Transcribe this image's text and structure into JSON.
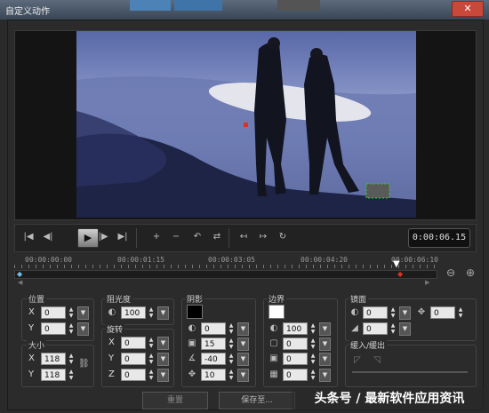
{
  "window": {
    "title": "自定义动作",
    "close_glyph": "✕"
  },
  "transport": {
    "buttons": [
      {
        "name": "go-to-start-button",
        "glyph": "|◀"
      },
      {
        "name": "previous-frame-button",
        "glyph": "◀|"
      },
      {
        "name": "play-button",
        "glyph": "▶"
      },
      {
        "name": "next-frame-button",
        "glyph": "|▶"
      },
      {
        "name": "go-to-end-button",
        "glyph": "▶|"
      }
    ],
    "edit_buttons": [
      {
        "name": "add-keyframe-button",
        "glyph": "+"
      },
      {
        "name": "remove-keyframe-button",
        "glyph": "−"
      },
      {
        "name": "reverse-keyframes-button",
        "glyph": "↶"
      },
      {
        "name": "swap-keyframes-button",
        "glyph": "⇄"
      },
      {
        "name": "move-left-keyframe-button",
        "glyph": "↤"
      },
      {
        "name": "move-right-keyframe-button",
        "glyph": "↦"
      },
      {
        "name": "redo-button",
        "glyph": "↻"
      }
    ],
    "timecode": "0:00:06.15"
  },
  "timeline": {
    "labels": [
      "00:00:00:00",
      "00:00:01:15",
      "00:00:03:05",
      "00:00:04:20",
      "00:00:06:10"
    ],
    "zoom_out": "⊖",
    "zoom_in": "⊕"
  },
  "position": {
    "title": "位置",
    "x_label": "X",
    "x": "0",
    "y_label": "Y",
    "y": "0"
  },
  "size": {
    "title": "大小",
    "x_label": "X",
    "x": "118",
    "y_label": "Y",
    "y": "118",
    "link_glyph": "⛓"
  },
  "opacity": {
    "title": "阻光度",
    "value": "100"
  },
  "rotation": {
    "title": "旋转",
    "x_label": "X",
    "x": "0",
    "y_label": "Y",
    "y": "0",
    "z_label": "Z",
    "z": "0"
  },
  "shadow": {
    "title": "阴影",
    "color": "#000000",
    "opacity": "0",
    "blur": "15",
    "angle": "-40",
    "distance": "10"
  },
  "border": {
    "title": "边界",
    "color": "#ffffff",
    "opacity": "100",
    "width": "0",
    "val3": "0",
    "val4": "0"
  },
  "mirror": {
    "title": "镜面",
    "opacity": "0",
    "offset": "0",
    "fade": "0"
  },
  "fade": {
    "title": "缓入/缓出"
  },
  "footer": {
    "reset": "重置",
    "save_as": "保存至..."
  },
  "watermark": "头条号 / 最新软件应用资讯",
  "colors": {
    "accent": "#4c82b5",
    "close": "#c8483a",
    "keyframe": "#ffffff"
  }
}
